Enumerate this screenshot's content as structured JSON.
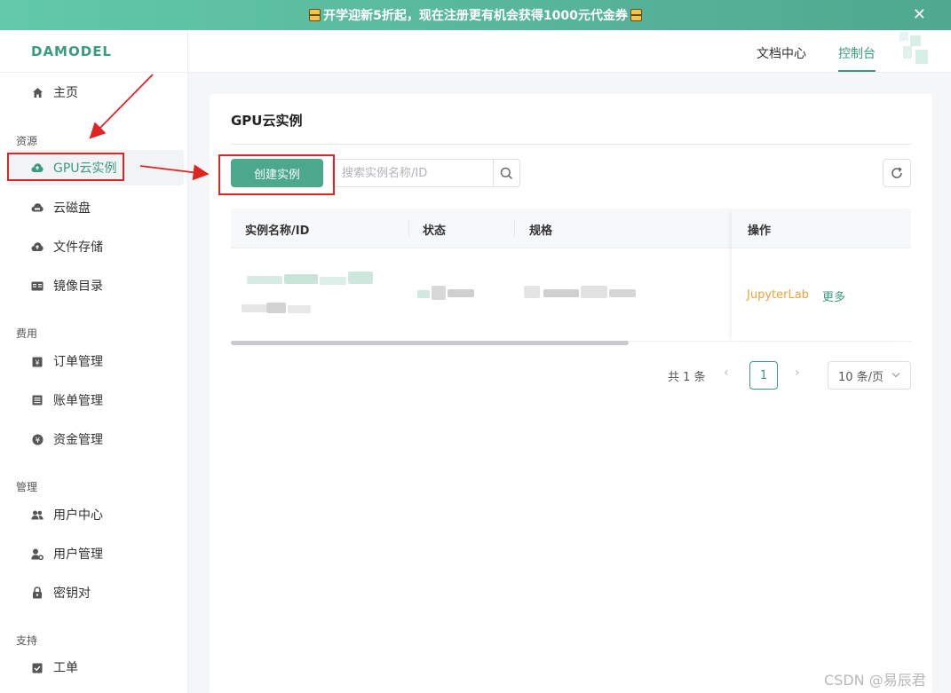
{
  "banner": {
    "text": "开学迎新5折起，现在注册更有机会获得1000元代金券",
    "close": "✕"
  },
  "header": {
    "logo": "DAMODEL",
    "nav": [
      {
        "label": "文档中心"
      },
      {
        "label": "控制台"
      }
    ]
  },
  "sidebar": {
    "home": "主页",
    "groups": [
      {
        "label": "资源",
        "items": [
          "GPU云实例",
          "云磁盘",
          "文件存储",
          "镜像目录"
        ]
      },
      {
        "label": "费用",
        "items": [
          "订单管理",
          "账单管理",
          "资金管理"
        ]
      },
      {
        "label": "管理",
        "items": [
          "用户中心",
          "用户管理",
          "密钥对"
        ]
      },
      {
        "label": "支持",
        "items": [
          "工单"
        ]
      }
    ],
    "active": "GPU云实例"
  },
  "main": {
    "title": "GPU云实例",
    "create_label": "创建实例",
    "search_placeholder": "搜索实例名称/ID",
    "table": {
      "columns": [
        "实例名称/ID",
        "状态",
        "规格",
        "操作"
      ],
      "row_actions": [
        "JupyterLab",
        "更多"
      ]
    },
    "pagination": {
      "total": "共 1 条",
      "page": "1",
      "page_size": "10 条/页",
      "prev": "‹",
      "next": "›"
    }
  },
  "watermark": "CSDN @易辰君",
  "colors": {
    "accent": "#3a9b7e",
    "button": "#4ba88a",
    "orange_link": "#e8a43a",
    "annotation": "#e02424"
  }
}
